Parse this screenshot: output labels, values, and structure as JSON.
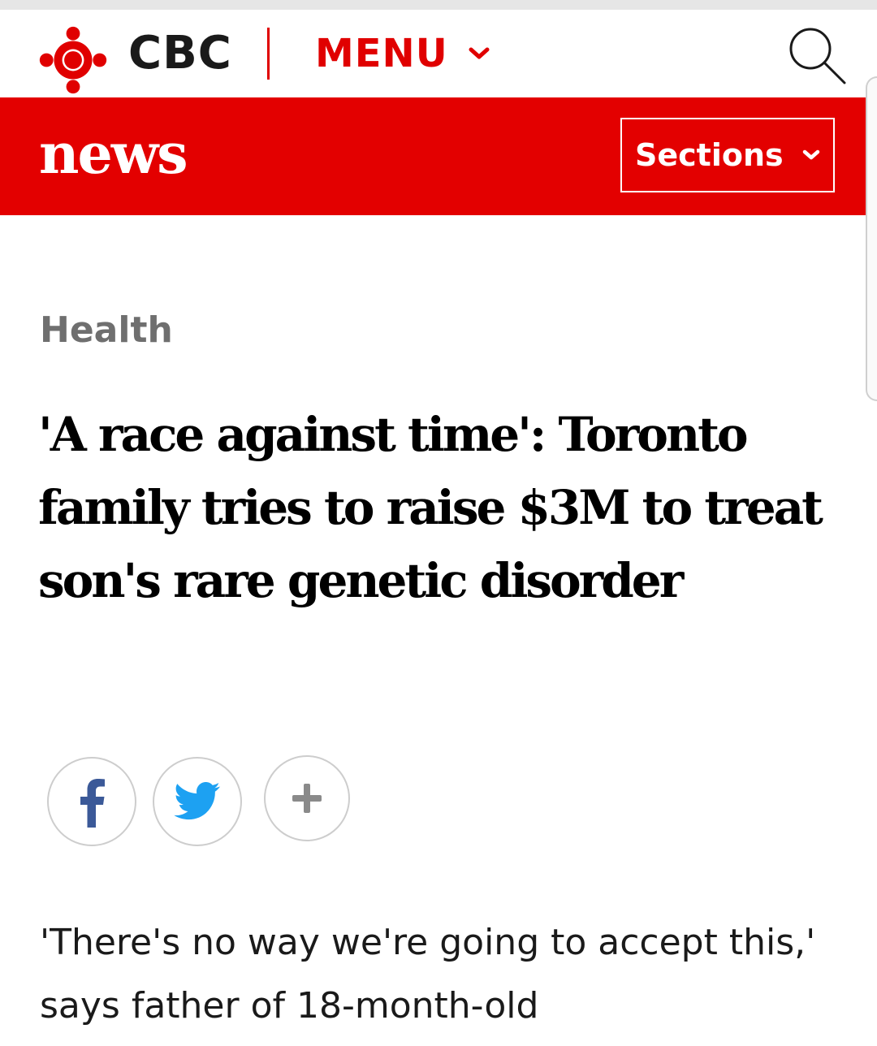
{
  "header": {
    "brand": "CBC",
    "menu_label": "MENU",
    "search_label": "Search"
  },
  "newsbar": {
    "title": "news",
    "sections_label": "Sections"
  },
  "article": {
    "category": "Health",
    "headline": "'A race against time': Toronto family tries to raise $3M to treat son's rare genetic disorder",
    "deck": "'There's no way we're going to accept this,' says father of 18-month-old"
  },
  "share": {
    "buttons": [
      {
        "icon": "facebook-icon",
        "label": "f"
      },
      {
        "icon": "twitter-icon"
      },
      {
        "icon": "plus-icon"
      }
    ]
  },
  "colors": {
    "brand_red": "#e30000",
    "kicker_gray": "#6f6f6f",
    "facebook_blue": "#3b5998",
    "twitter_blue": "#1da1f2",
    "icon_gray": "#8a8a8a"
  }
}
